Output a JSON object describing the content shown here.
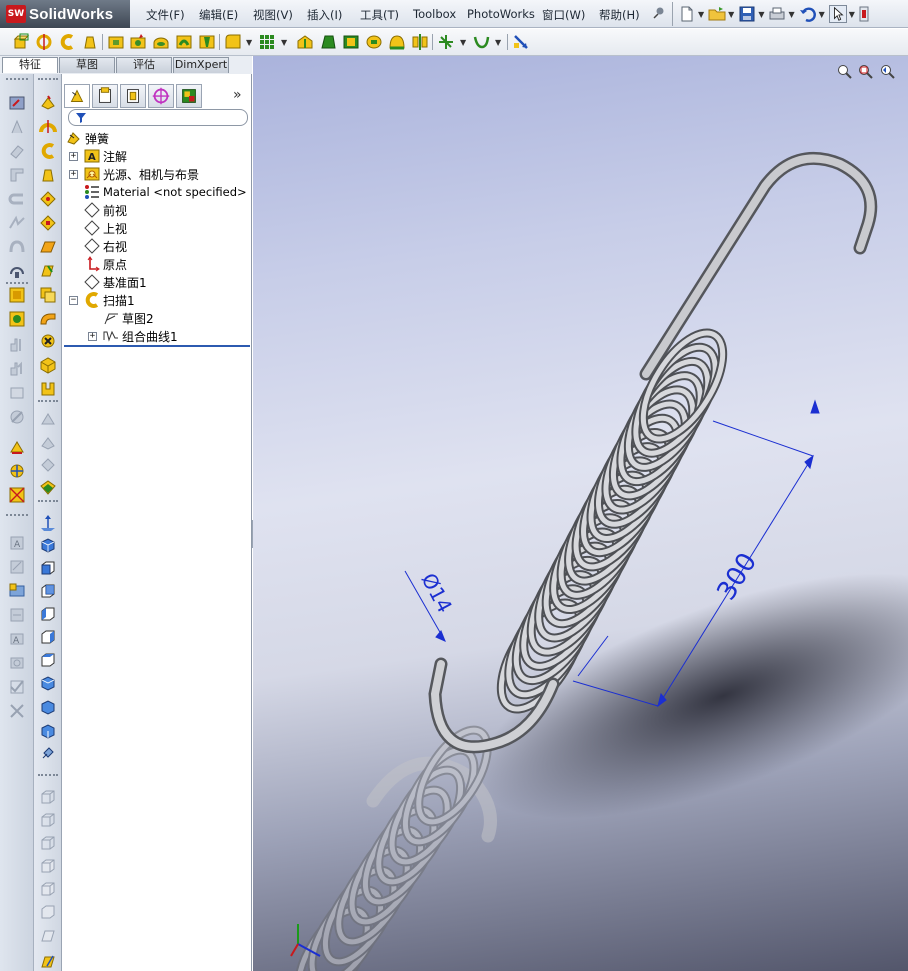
{
  "app": {
    "logo_badge": "SW",
    "logo_text": "SolidWorks"
  },
  "menu": {
    "items": [
      "文件(F)",
      "编辑(E)",
      "视图(V)",
      "插入(I)",
      "工具(T)",
      "Toolbox",
      "PhotoWorks",
      "窗口(W)",
      "帮助(H)"
    ]
  },
  "tabs": [
    "特征",
    "草图",
    "评估",
    "DimXpert"
  ],
  "tree": {
    "root": "弹簧",
    "items": [
      {
        "label": "注解",
        "icon": "annotation-icon",
        "expander": "+"
      },
      {
        "label": "光源、相机与布景",
        "icon": "lights-cameras-icon",
        "expander": "+"
      },
      {
        "label": "Material <not specified>",
        "icon": "material-icon",
        "expander": ""
      },
      {
        "label": "前视",
        "icon": "plane-icon",
        "expander": ""
      },
      {
        "label": "上视",
        "icon": "plane-icon",
        "expander": ""
      },
      {
        "label": "右视",
        "icon": "plane-icon",
        "expander": ""
      },
      {
        "label": "原点",
        "icon": "origin-icon",
        "expander": ""
      },
      {
        "label": "基准面1",
        "icon": "plane-icon",
        "expander": ""
      },
      {
        "label": "扫描1",
        "icon": "sweep-icon",
        "expander": "−"
      },
      {
        "label": "草图2",
        "icon": "sketch-icon",
        "expander": ""
      },
      {
        "label": "组合曲线1",
        "icon": "composite-curve-icon",
        "expander": "+"
      }
    ],
    "more_tabs": "»"
  },
  "viewport": {
    "dimension_length": "300",
    "dimension_diameter": "Ø14"
  },
  "colors": {
    "dimension": "#1b2fd1",
    "spring": "#8d8f93",
    "accent": "#c8191d"
  }
}
